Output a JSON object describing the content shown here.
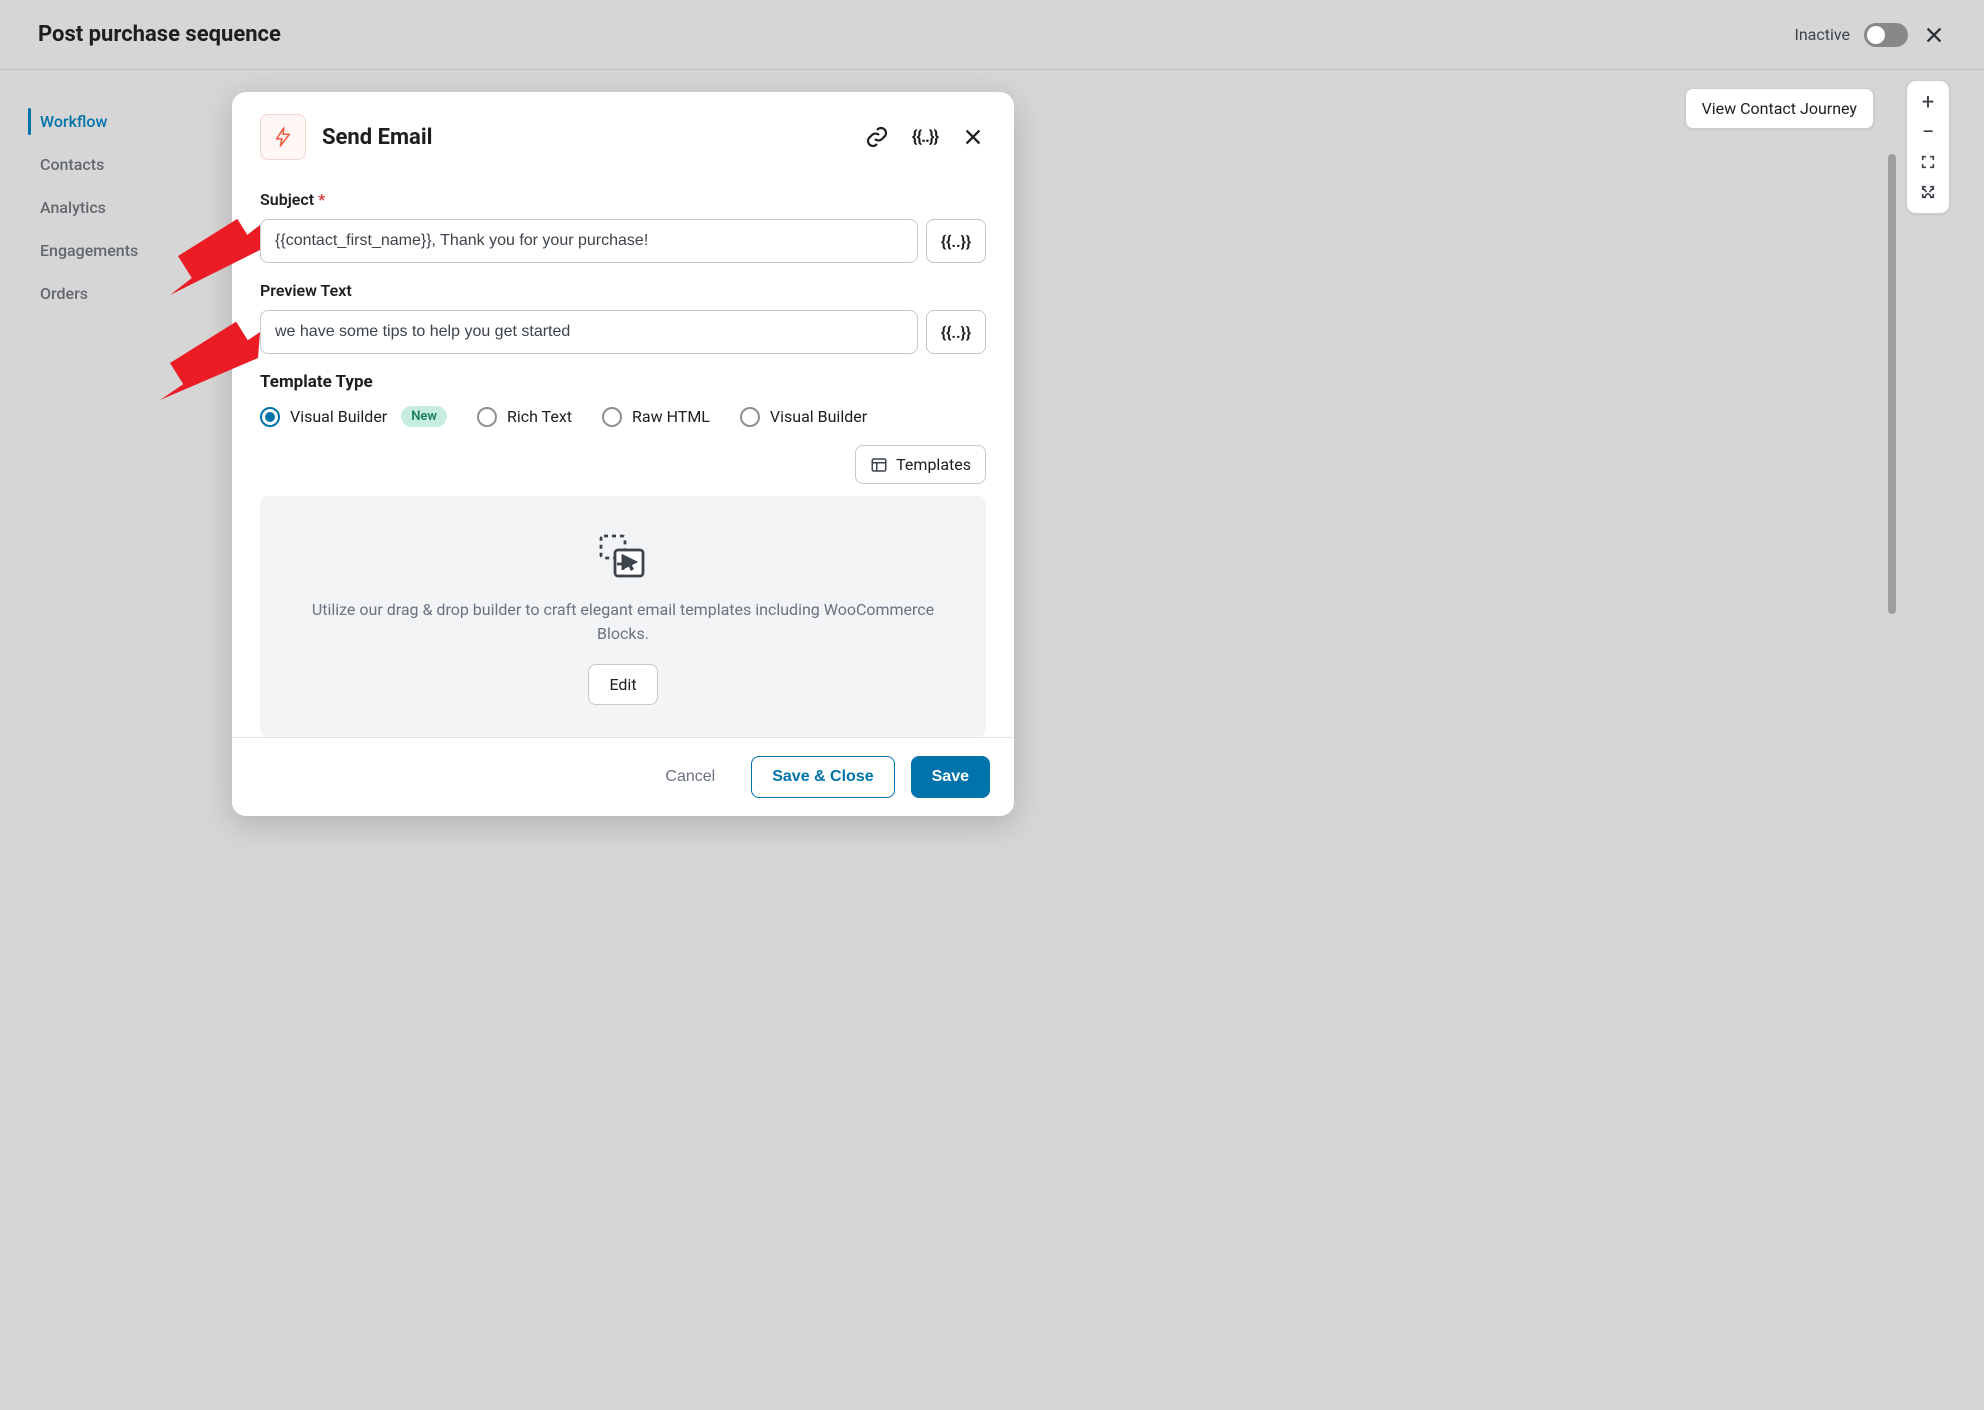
{
  "header": {
    "title": "Post purchase sequence",
    "status": "Inactive"
  },
  "sidebar": {
    "items": [
      {
        "label": "Workflow",
        "active": true
      },
      {
        "label": "Contacts"
      },
      {
        "label": "Analytics"
      },
      {
        "label": "Engagements"
      },
      {
        "label": "Orders"
      }
    ]
  },
  "journey_button": "View Contact Journey",
  "modal": {
    "title": "Send Email",
    "subject_label": "Subject",
    "subject_value": "{{contact_first_name}}, Thank you for your purchase!",
    "preview_label": "Preview Text",
    "preview_value": "we have some tips to help you get started",
    "template_type_label": "Template Type",
    "template_options": [
      {
        "label": "Visual Builder",
        "selected": true,
        "badge": "New"
      },
      {
        "label": "Rich Text"
      },
      {
        "label": "Raw HTML"
      },
      {
        "label": "Visual Builder"
      }
    ],
    "templates_button": "Templates",
    "dropzone_text": "Utilize our drag & drop builder to craft elegant email templates including WooCommerce Blocks.",
    "edit_button": "Edit",
    "merge_glyph": "{{..}}",
    "footer": {
      "cancel": "Cancel",
      "save_close": "Save & Close",
      "save": "Save"
    }
  }
}
